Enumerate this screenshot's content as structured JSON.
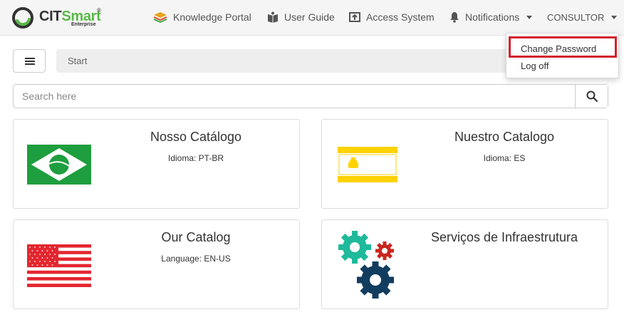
{
  "header": {
    "logo": {
      "brand_dark": "CIT",
      "brand_green": "Smart",
      "sub": "Enterprise",
      "reg": "®"
    },
    "nav": [
      {
        "label": "Knowledge Portal",
        "icon": "stack-icon"
      },
      {
        "label": "User Guide",
        "icon": "book-icon"
      },
      {
        "label": "Access System",
        "icon": "external-window-icon"
      },
      {
        "label": "Notifications",
        "icon": "bell-icon"
      }
    ],
    "user_menu_label": "CONSULTOR"
  },
  "user_dropdown": {
    "items": [
      {
        "label": "Change Password",
        "highlighted": true
      },
      {
        "label": "Log off"
      }
    ]
  },
  "breadcrumb": {
    "label": "Start"
  },
  "search": {
    "placeholder": "Search here",
    "value": ""
  },
  "cards": [
    {
      "title": "Nosso Catálogo",
      "subtitle": "Idioma: PT-BR",
      "image": "brazil-flag"
    },
    {
      "title": "Nuestro Catalogo",
      "subtitle": "Idioma: ES",
      "image": "spain-flag"
    },
    {
      "title": "Our Catalog",
      "subtitle": "Language: EN-US",
      "image": "usa-flag"
    },
    {
      "title": "Serviços de Infraestrutura",
      "subtitle": "",
      "image": "gears-image"
    }
  ],
  "colors": {
    "brand_green": "#58b947",
    "highlight_red": "#d3202a",
    "topbar_bg": "#f5f5f5",
    "brazil_green": "#1e9e3e",
    "spain_yellow": "#ffd200",
    "usa_red": "#e3262f",
    "gear_teal": "#1fb99b",
    "gear_red": "#c9271f",
    "gear_navy": "#123d5e"
  }
}
